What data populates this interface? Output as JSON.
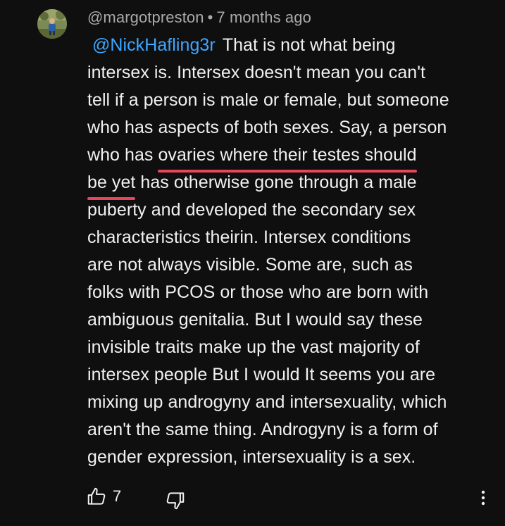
{
  "comment": {
    "author": "@margotpreston",
    "separator": "•",
    "timestamp": "7 months ago",
    "mention": "@NickHafling3r",
    "lines": [
      "That is not what being",
      "intersex is. Intersex doesn't mean you can't",
      "tell if a person is male or female, but someone",
      "who has aspects of both sexes. Say, a person",
      "who has ",
      "ovaries where their testes should",
      "be yet",
      " has otherwise gone through a male",
      "puberty and developed the secondary sex",
      "characteristics theirin. Intersex conditions",
      "are not always visible. Some are, such as",
      "folks with PCOS or those who are born with",
      "ambiguous genitalia. But I would say these",
      "invisible traits make up the vast majority of",
      "intersex people But I would  It seems you are",
      "mixing up androgyny and intersexuality, which",
      "aren't the same thing. Androgyny is a form of",
      "gender expression, intersexuality is a sex."
    ],
    "like_count": "7"
  },
  "icons": {
    "avatar": "avatar-image",
    "like": "thumbs-up-icon",
    "dislike": "thumbs-down-icon",
    "more": "more-vertical-icon"
  },
  "colors": {
    "background": "#0f0f0f",
    "text": "#f1f1f1",
    "meta": "#aaaaaa",
    "mention": "#3ea6ff",
    "highlight_underline": "#e8465b"
  }
}
